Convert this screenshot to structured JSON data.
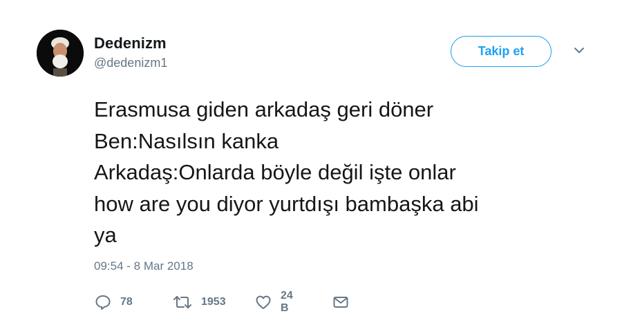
{
  "author": {
    "display_name": "Dedenizm",
    "handle": "@dedenizm1"
  },
  "follow_button": {
    "label": "Takip et"
  },
  "tweet": {
    "lines": [
      "Erasmusa giden arkadaş geri döner",
      "Ben:Nasılsın kanka",
      "Arkadaş:Onlarda böyle değil işte onlar",
      "how are you diyor yurtdışı bambaşka abi",
      "ya"
    ],
    "timestamp": "09:54 - 8 Mar 2018"
  },
  "actions": {
    "replies": "78",
    "retweets": "1953",
    "likes": "24 B"
  },
  "icons": {
    "reply": "reply-icon",
    "retweet": "retweet-icon",
    "like": "heart-icon",
    "message": "envelope-icon",
    "menu": "chevron-down-icon"
  },
  "colors": {
    "accent": "#1da1f2",
    "secondary_text": "#657786",
    "primary_text": "#14171a"
  }
}
